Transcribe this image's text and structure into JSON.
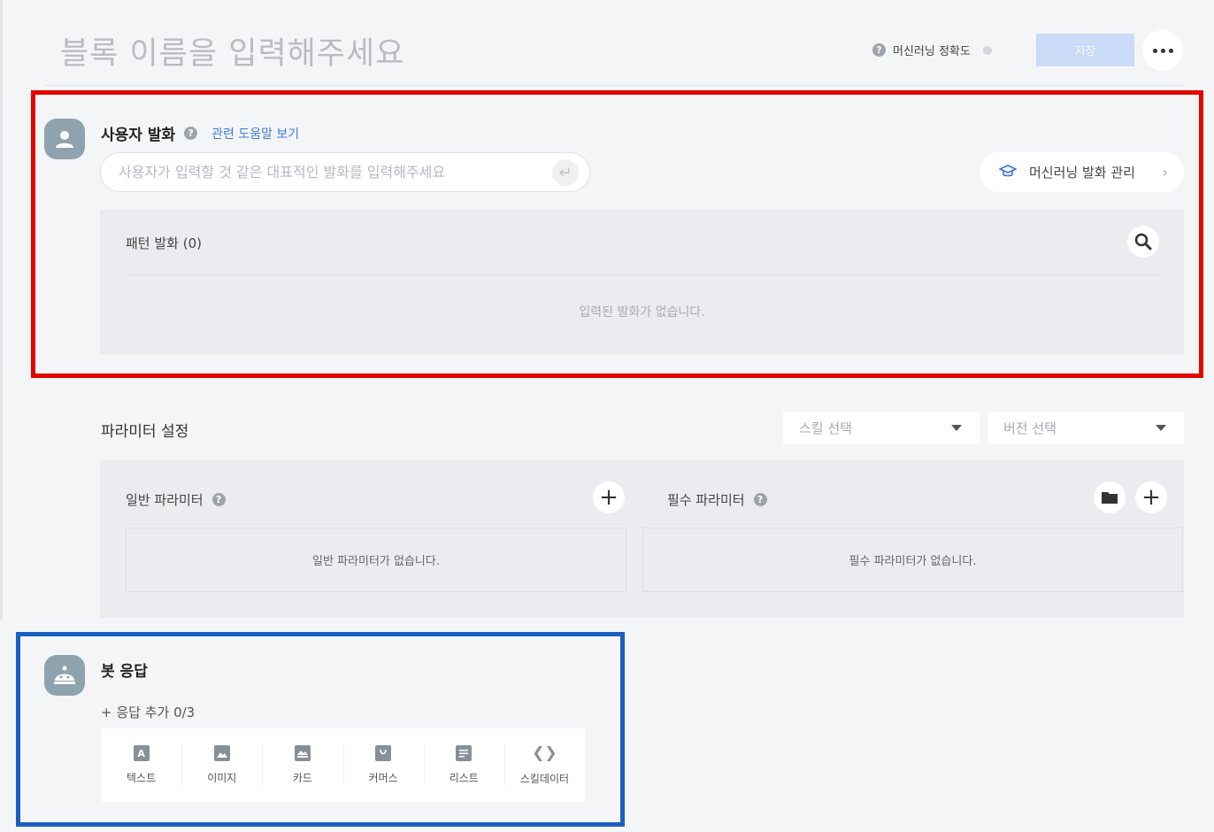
{
  "header": {
    "title_placeholder": "블록 이름을 입력해주세요",
    "ml_accuracy_label": "머신러닝 정확도",
    "save_label": "저장"
  },
  "user_utterance": {
    "title": "사용자 발화",
    "help_link": "관련 도움말 보기",
    "input_placeholder": "사용자가 입력할 것 같은 대표적인 발화를 입력해주세요",
    "ml_manage_label": "머신러닝 발화 관리",
    "pattern_title": "패턴 발화 (0)",
    "pattern_empty": "입력된 발화가 없습니다."
  },
  "parameters": {
    "title": "파라미터 설정",
    "skill_select": "스킬 선택",
    "version_select": "버전 선택",
    "general_label": "일반 파라미터",
    "general_empty": "일반 파라미터가 없습니다.",
    "required_label": "필수 파라미터",
    "required_empty": "필수 파라미터가 없습니다."
  },
  "bot_response": {
    "title": "봇 응답",
    "add_label": "+ 응답 추가 0/3",
    "types": [
      {
        "label": "텍스트",
        "icon": "text-icon"
      },
      {
        "label": "이미지",
        "icon": "image-icon"
      },
      {
        "label": "카드",
        "icon": "card-icon"
      },
      {
        "label": "커머스",
        "icon": "commerce-icon"
      },
      {
        "label": "리스트",
        "icon": "list-icon"
      },
      {
        "label": "스킬데이터",
        "icon": "code-icon"
      }
    ]
  },
  "colors": {
    "highlight_red": "#e10600",
    "highlight_blue": "#1a5fbf",
    "link_blue": "#3b7ddd"
  }
}
